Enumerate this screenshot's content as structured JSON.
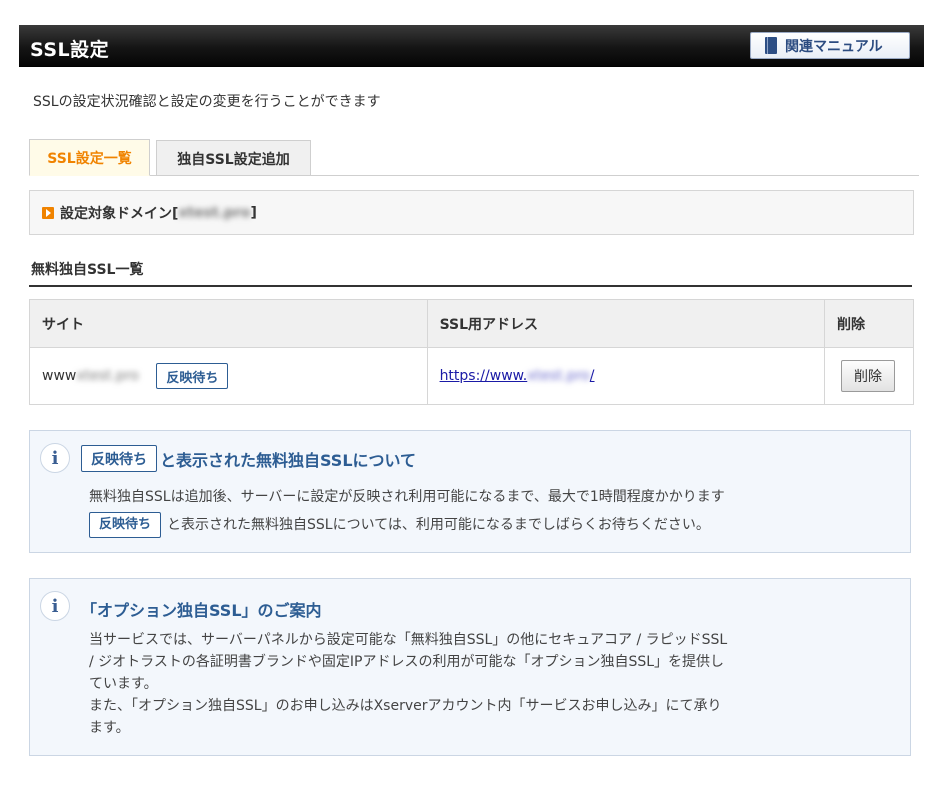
{
  "header": {
    "title": "SSL設定",
    "manual_label": "関連マニュアル"
  },
  "description": "SSLの設定状況確認と設定の変更を行うことができます",
  "tabs": [
    {
      "label": "SSL設定一覧",
      "active": true
    },
    {
      "label": "独自SSL設定追加",
      "active": false
    }
  ],
  "domain": {
    "label": "設定対象ドメイン[",
    "value": "xtest.pro",
    "suffix": "]"
  },
  "section_title": "無料独自SSL一覧",
  "table": {
    "headers": [
      "サイト",
      "SSL用アドレス",
      "削除"
    ],
    "rows": [
      {
        "site_prefix": "www",
        "site_domain": "xtest.pro",
        "status_badge": "反映待ち",
        "address_prefix": "https://www.",
        "address_domain": "xtest.pro",
        "address_suffix": "/",
        "delete_label": "削除"
      }
    ]
  },
  "info1": {
    "badge": "反映待ち",
    "heading": "と表示された無料独自SSLについて",
    "line1": "無料独自SSLは追加後、サーバーに設定が反映され利用可能になるまで、最大で1時間程度かかります",
    "line2_badge": "反映待ち",
    "line2": "と表示された無料独自SSLについては、利用可能になるまでしばらくお待ちください。"
  },
  "info2": {
    "heading": "「オプション独自SSL」のご案内",
    "line1": "当サービスでは、サーバーパネルから設定可能な「無料独自SSL」の他にセキュアコア / ラピッドSSL",
    "line2": "/ ジオトラストの各証明書ブランドや固定IPアドレスの利用が可能な「オプション独自SSL」を提供し",
    "line3": "ています。",
    "line4": "また、「オプション独自SSL」のお申し込みはXserverアカウント内「サービスお申し込み」にて承り",
    "line5": "ます。"
  },
  "colors": {
    "accent_orange": "#f08300",
    "link_blue": "#1a1aa6",
    "badge_blue": "#2d5d93"
  }
}
